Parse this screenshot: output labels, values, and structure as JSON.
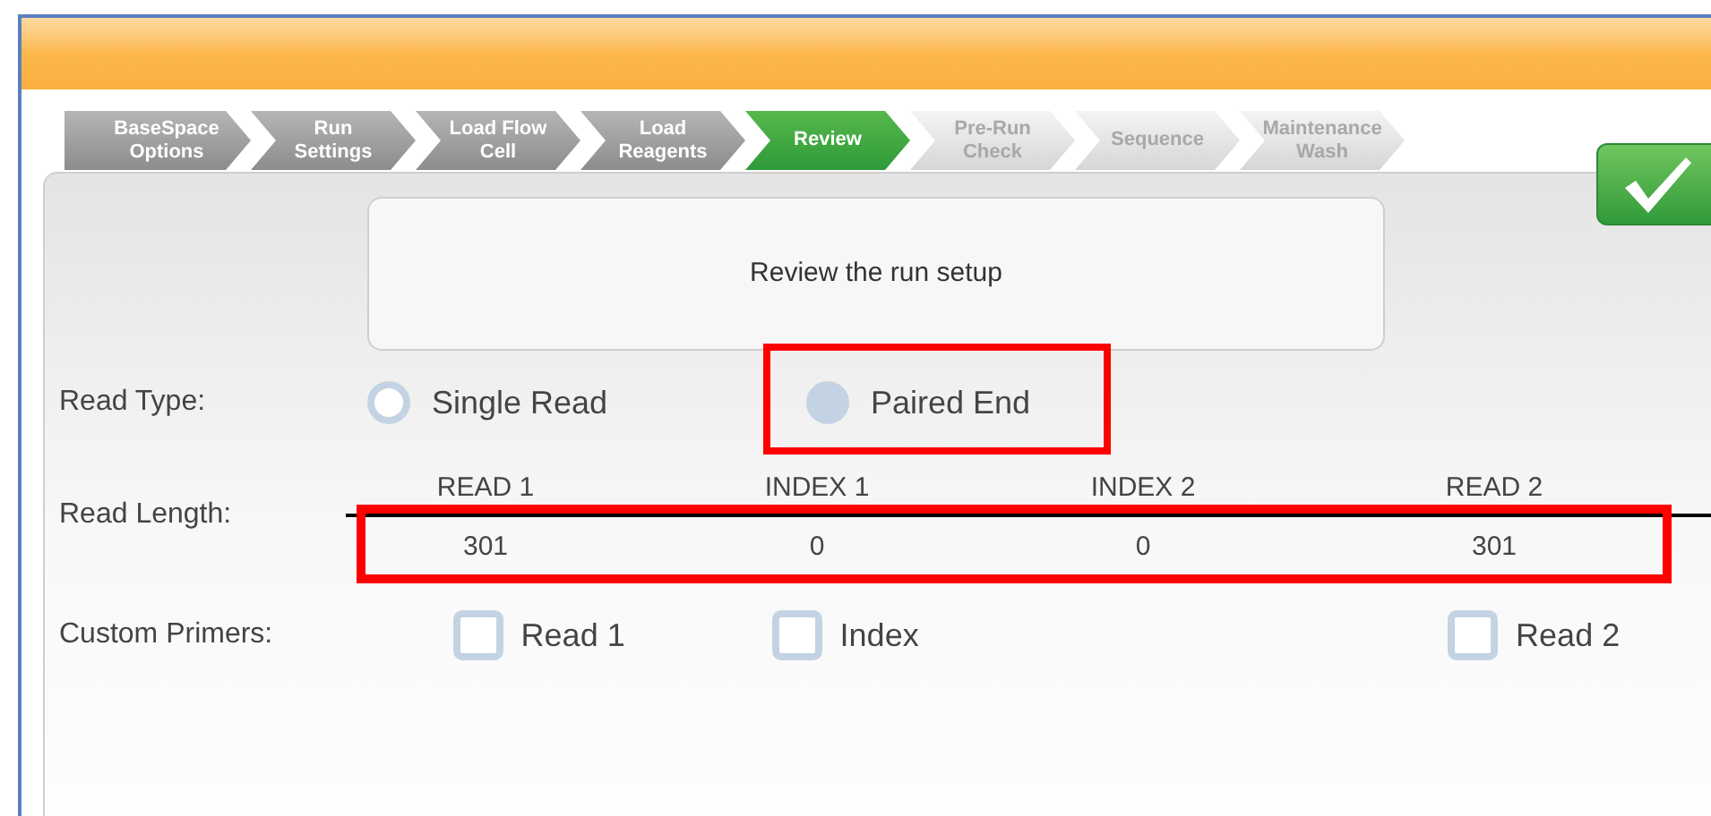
{
  "steps": [
    {
      "label": "BaseSpace Options",
      "completed": true,
      "selected": false
    },
    {
      "label": "Run Settings",
      "completed": true,
      "selected": false
    },
    {
      "label": "Load Flow Cell",
      "completed": true,
      "selected": false
    },
    {
      "label": "Load Reagents",
      "completed": true,
      "selected": false
    },
    {
      "label": "Review",
      "completed": false,
      "selected": true
    },
    {
      "label": "Pre-Run Check",
      "completed": false,
      "selected": false
    },
    {
      "label": "Sequence",
      "completed": false,
      "selected": false
    },
    {
      "label": "Maintenance Wash",
      "completed": false,
      "selected": false
    }
  ],
  "message": "Review the run setup",
  "read_type": {
    "label": "Read Type:",
    "options": [
      {
        "label": "Single Read",
        "selected": false,
        "highlighted": false
      },
      {
        "label": "Paired End",
        "selected": true,
        "highlighted": true
      }
    ]
  },
  "read_length": {
    "label": "Read Length:",
    "highlighted": true,
    "columns": [
      {
        "header": "READ 1",
        "value": "301"
      },
      {
        "header": "INDEX 1",
        "value": "0"
      },
      {
        "header": "INDEX 2",
        "value": "0"
      },
      {
        "header": "READ 2",
        "value": "301"
      }
    ]
  },
  "custom_primers": {
    "label": "Custom Primers:",
    "options": [
      {
        "label": "Read 1",
        "checked": false
      },
      {
        "label": "Index",
        "checked": false
      },
      {
        "label": "Read 2",
        "checked": false
      }
    ]
  }
}
